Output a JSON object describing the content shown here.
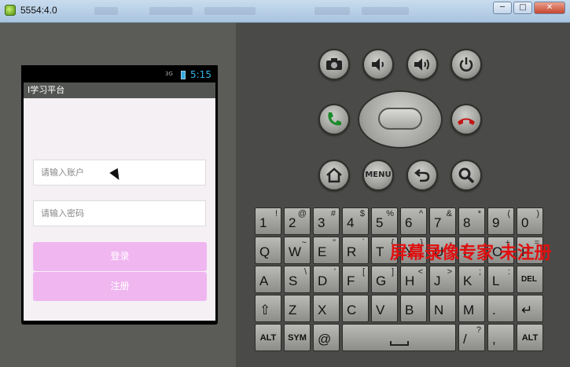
{
  "window": {
    "title": "5554:4.0"
  },
  "phone": {
    "status": {
      "clock": "5:15",
      "signal": "3G"
    },
    "app_title": "I学习平台",
    "username_placeholder": "请输入账户",
    "password_placeholder": "请输入密码",
    "login_label": "登录",
    "register_label": "注册"
  },
  "controls": {
    "camera": "camera-icon",
    "vol_down": "volume-down-icon",
    "vol_up": "volume-up-icon",
    "power": "power-icon",
    "call": "call-icon",
    "end_call": "end-call-icon",
    "home": "home-icon",
    "menu_label": "MENU",
    "back": "back-icon",
    "search": "search-icon"
  },
  "keyboard": {
    "row1": [
      [
        "1",
        "!"
      ],
      [
        "2",
        "@"
      ],
      [
        "3",
        "#"
      ],
      [
        "4",
        "$"
      ],
      [
        "5",
        "%"
      ],
      [
        "6",
        "^"
      ],
      [
        "7",
        "&"
      ],
      [
        "8",
        "*"
      ],
      [
        "9",
        "("
      ],
      [
        "0",
        ")"
      ]
    ],
    "row2": [
      [
        "Q",
        ""
      ],
      [
        "W",
        "~"
      ],
      [
        "E",
        "\""
      ],
      [
        "R",
        "`"
      ],
      [
        "T",
        "{"
      ],
      [
        "Y",
        "}"
      ],
      [
        "U",
        "-"
      ],
      [
        "I",
        ""
      ],
      [
        "O",
        "+"
      ],
      [
        "P",
        "="
      ]
    ],
    "row3": [
      [
        "A",
        ""
      ],
      [
        "S",
        "\\"
      ],
      [
        "D",
        "'"
      ],
      [
        "F",
        "["
      ],
      [
        "G",
        "]"
      ],
      [
        "H",
        "<"
      ],
      [
        "J",
        ">"
      ],
      [
        "K",
        ";"
      ],
      [
        "L",
        ":"
      ],
      [
        "DEL",
        ""
      ]
    ],
    "row4": [
      [
        "⇧",
        ""
      ],
      [
        "Z",
        ""
      ],
      [
        "X",
        ""
      ],
      [
        "C",
        ""
      ],
      [
        "V",
        ""
      ],
      [
        "B",
        ""
      ],
      [
        "N",
        ""
      ],
      [
        "M",
        ""
      ],
      [
        ".",
        ""
      ],
      [
        "↵",
        ""
      ]
    ],
    "alt_label": "ALT",
    "sym_label": "SYM",
    "at_label": "@",
    "slash_label": "/",
    "comma_label": ",",
    "question_label": "?"
  },
  "watermark": "屏幕录像专家 未注册",
  "colors": {
    "accent_button": "#f0b6f0",
    "clock": "#35b5e5",
    "watermark": "#e01010"
  }
}
